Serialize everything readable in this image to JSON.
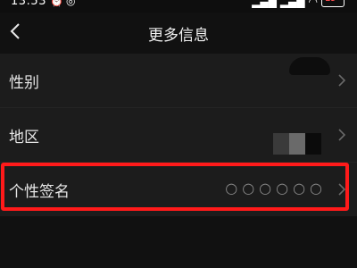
{
  "status_bar": {
    "time": "13:53",
    "battery": "19",
    "battery_color": "#ff4d4f",
    "icons": [
      "alarm-icon",
      "location-icon",
      "signal-icon",
      "signal-icon",
      "wifi-icon",
      "battery-icon"
    ]
  },
  "header": {
    "title": "更多信息",
    "back_icon": "chevron-left-icon"
  },
  "rows": [
    {
      "label": "性别",
      "value": ""
    },
    {
      "label": "地区",
      "value": ""
    },
    {
      "label": "个性签名",
      "value": "○○○○○○"
    }
  ],
  "highlight_color": "#ff1a1a"
}
